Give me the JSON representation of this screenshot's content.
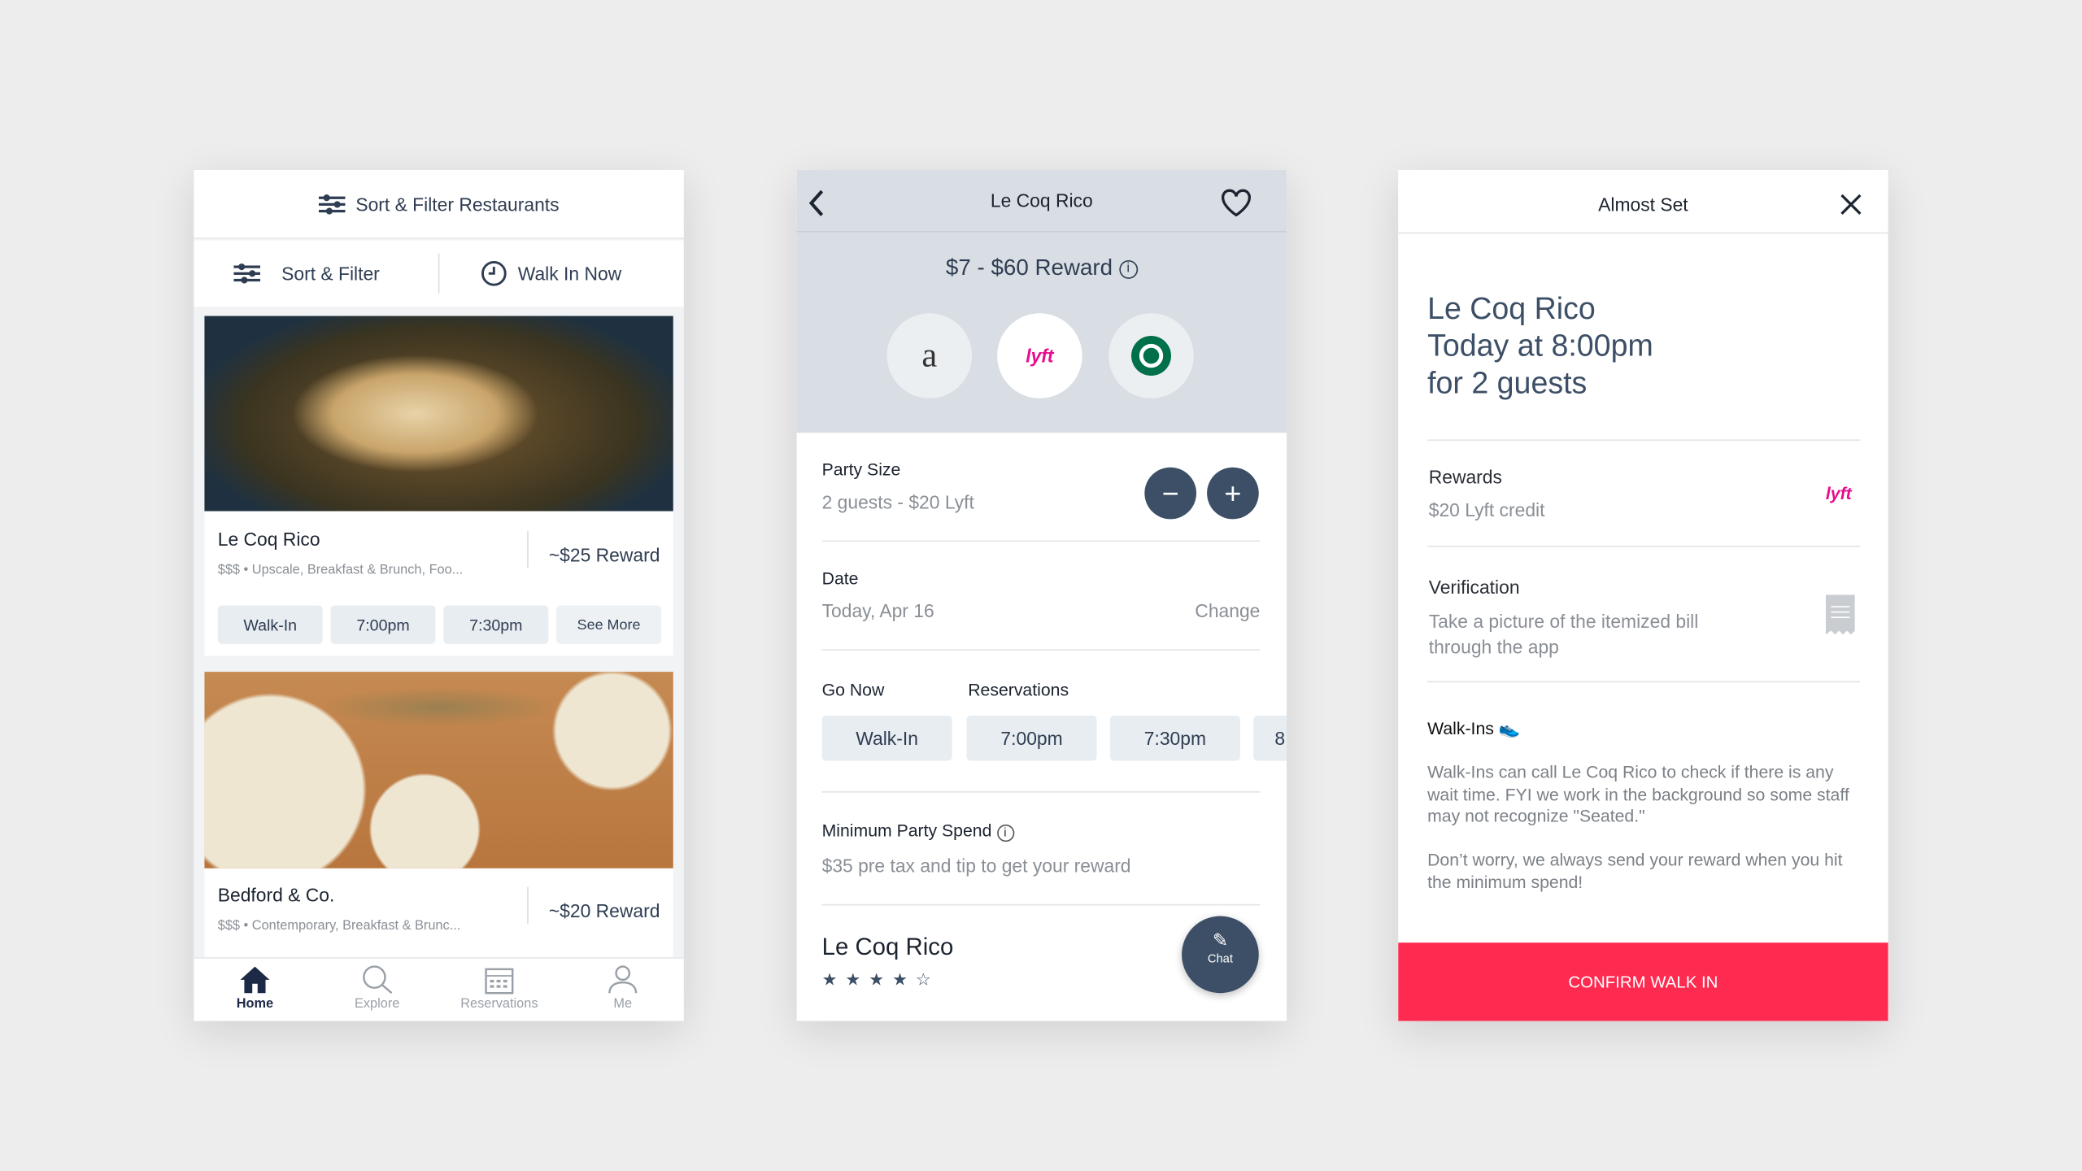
{
  "colors": {
    "accent": "#ff2a50",
    "navy": "#2f3d52",
    "lyft": "#ea0b8c",
    "background": "#ededed"
  },
  "screen1": {
    "header_title": "Sort & Filter Restaurants",
    "sort_filter_label": "Sort & Filter",
    "walk_in_now_label": "Walk In Now",
    "restaurants": [
      {
        "name": "Le Coq Rico",
        "details": "$$$ • Upscale, Breakfast & Brunch, Foo...",
        "reward": "~$25 Reward",
        "times": [
          "Walk-In",
          "7:00pm",
          "7:30pm",
          "See More"
        ]
      },
      {
        "name": "Bedford & Co.",
        "details": "$$$ • Contemporary, Breakfast & Brunc...",
        "reward": "~$20 Reward"
      }
    ],
    "tabs": [
      {
        "label": "Home",
        "icon": "home-icon"
      },
      {
        "label": "Explore",
        "icon": "search-icon"
      },
      {
        "label": "Reservations",
        "icon": "calendar-icon"
      },
      {
        "label": "Me",
        "icon": "user-icon"
      }
    ]
  },
  "screen2": {
    "title": "Le Coq Rico",
    "reward_range": "$7 - $60 Reward",
    "partners": [
      "amazon",
      "lyft",
      "starbucks"
    ],
    "party_size_label": "Party Size",
    "party_size_value": "2 guests - $20 Lyft",
    "date_label": "Date",
    "date_value": "Today, Apr 16",
    "change_label": "Change",
    "go_now_label": "Go Now",
    "reservations_label": "Reservations",
    "times": [
      "Walk-In",
      "7:00pm",
      "7:30pm",
      "8"
    ],
    "min_spend_label": "Minimum Party Spend",
    "min_spend_value": "$35 pre tax and tip to get your reward",
    "restaurant_name": "Le Coq Rico",
    "rating": 4.5,
    "chat_label": "Chat"
  },
  "screen3": {
    "title": "Almost Set",
    "summary": [
      "Le Coq Rico",
      "Today at 8:00pm",
      "for 2 guests"
    ],
    "rewards_label": "Rewards",
    "rewards_value": "$20 Lyft credit",
    "verification_label": "Verification",
    "verification_value": "Take a picture of the itemized bill through the app",
    "walkins_label": "Walk-Ins",
    "walkins_text1": "Walk-Ins can call Le Coq Rico to check if there is any wait time. FYI we work in the background so some staff may not recognize \"Seated.\"",
    "walkins_text2": "Don’t worry, we always send your reward when you hit the minimum spend!",
    "confirm_label": "CONFIRM WALK IN"
  }
}
